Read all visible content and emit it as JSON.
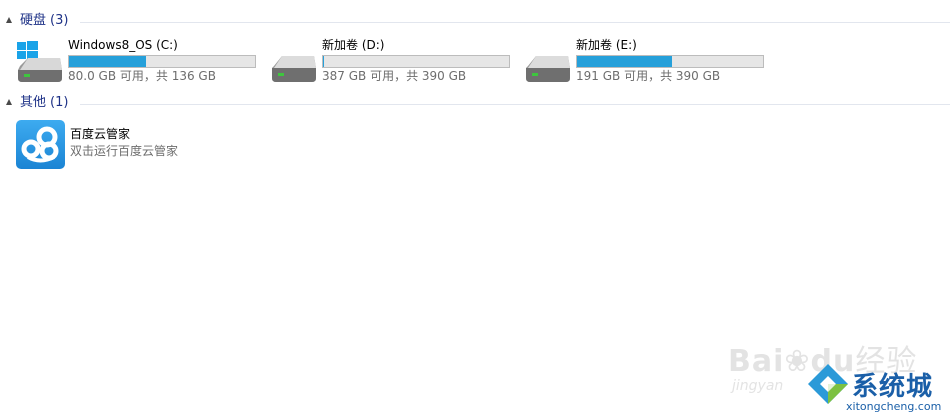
{
  "groups": {
    "drives": {
      "title": "硬盘",
      "count": "(3)"
    },
    "other": {
      "title": "其他",
      "count": "(1)"
    }
  },
  "drives": [
    {
      "name": "Windows8_OS (C:)",
      "info": "80.0 GB 可用，共 136 GB",
      "used_fraction": 0.412,
      "icon": "system-drive-icon"
    },
    {
      "name": "新加卷 (D:)",
      "info": "387 GB 可用，共 390 GB",
      "used_fraction": 0.008,
      "icon": "hard-drive-icon"
    },
    {
      "name": "新加卷 (E:)",
      "info": "191 GB 可用，共 390 GB",
      "used_fraction": 0.51,
      "icon": "hard-drive-icon"
    }
  ],
  "app": {
    "name": "百度云管家",
    "description": "双击运行百度云管家",
    "icon": "baidu-cloud-icon"
  },
  "watermarks": {
    "baidu_latin": "Bai",
    "baidu_latin2": "du",
    "baidu_zh": "经验",
    "jingyan": "jingyan",
    "site_brand": "系统城",
    "site_domain": "xitongcheng.com"
  },
  "colors": {
    "header_text": "#1e3287",
    "bar_fill": "#26a0da",
    "bar_bg": "#e6e6e6",
    "info_text": "#6d6d6d"
  }
}
